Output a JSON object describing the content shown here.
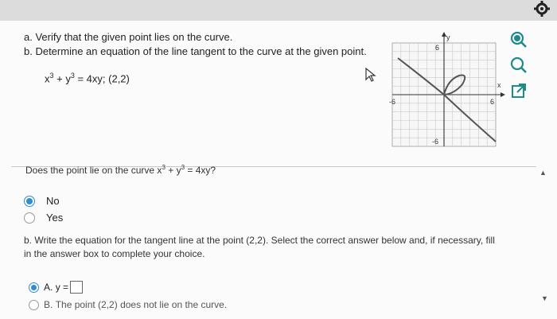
{
  "question": {
    "line_a": "a. Verify that the given point lies on the curve.",
    "line_b": "b. Determine an equation of the line tangent to the curve at the given point.",
    "equation": {
      "x_term": "x",
      "x_exp": "3",
      "plus": " + y",
      "y_exp": "3",
      "rest": " = 4xy; (2,2)"
    }
  },
  "graph": {
    "y_label": "y",
    "x_label": "x",
    "y_max_label": "6",
    "y_min_label": "-6",
    "x_min_label": "-6",
    "x_max_label": "6"
  },
  "part_a": {
    "prompt_prefix": "Does the point lie on the curve x",
    "prompt_exp1": "3",
    "prompt_mid": " + y",
    "prompt_exp2": "3",
    "prompt_suffix": " = 4xy?",
    "options": [
      {
        "label": "No",
        "selected": true
      },
      {
        "label": "Yes",
        "selected": false
      }
    ]
  },
  "part_b": {
    "prompt": "b. Write the equation for the tangent line at the point (2,2). Select the correct answer below and, if necessary, fill in the answer box to complete your choice.",
    "option_a_letter": "A.",
    "option_a_text": "y =",
    "option_b_letter": "B.",
    "option_b_text": "The point (2,2) does not lie on the curve."
  },
  "icons": {
    "gear": "gear-icon",
    "zoom_in": "zoom-in-icon",
    "zoom_out": "zoom-out-icon",
    "external": "external-link-icon",
    "cursor": "cursor-icon"
  },
  "colors": {
    "accent": "#2f8ccf",
    "icon_teal": "#1f8a8a",
    "curve": "#555555"
  }
}
